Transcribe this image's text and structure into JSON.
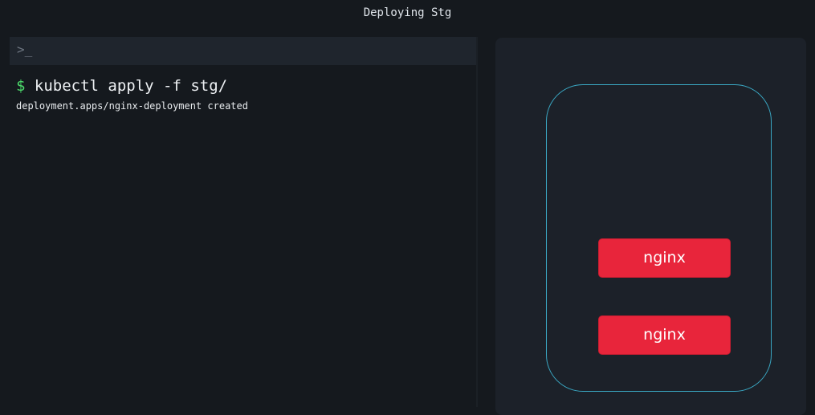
{
  "window": {
    "title": "Deploying Stg"
  },
  "terminal": {
    "icon": "terminal-prompt-icon",
    "icon_glyph": ">_",
    "prompt": "$",
    "command": "kubectl apply -f stg/",
    "output": "deployment.apps/nginx-deployment created"
  },
  "cluster": {
    "node": {
      "pods": [
        {
          "label": "nginx"
        },
        {
          "label": "nginx"
        }
      ]
    }
  },
  "colors": {
    "background": "#15191e",
    "prompt": "#4cd96b",
    "node_border": "#3aa8c4",
    "pod": "#e8253b"
  }
}
